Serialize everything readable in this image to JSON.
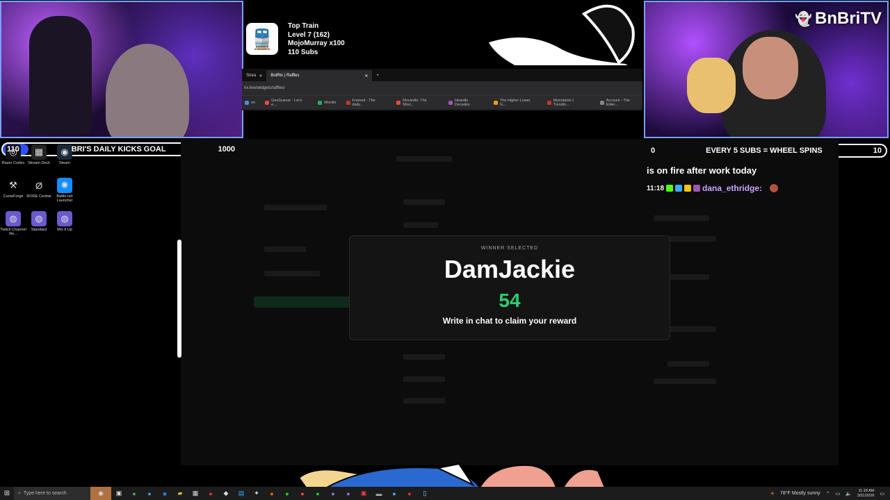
{
  "streamer": {
    "name": "BnBriTV"
  },
  "goals": {
    "left": {
      "current": "110",
      "label": "BRI'S DAILY KICKS GOAL",
      "target": "1000",
      "progress": 0.11
    },
    "right": {
      "current": "0",
      "label": "EVERY 5 SUBS = WHEEL SPINS",
      "target": "10",
      "progress": 0
    }
  },
  "desktop_icons": [
    {
      "label": "Razer Cortex",
      "icon": "razer-icon"
    },
    {
      "label": "Stream Deck",
      "icon": "stream-deck-icon"
    },
    {
      "label": "Steam",
      "icon": "steam-icon"
    },
    {
      "label": "CurseForge",
      "icon": "curseforge-icon"
    },
    {
      "label": "RODE Central",
      "icon": "rode-icon"
    },
    {
      "label": "Battle.net Launcher",
      "icon": "battlenet-icon"
    },
    {
      "label": "Twitch Channel Re...",
      "icon": "twitch-fingerprint-icon"
    },
    {
      "label": "Standard",
      "icon": "twitch-fingerprint-icon"
    },
    {
      "label": "Mix It Up",
      "icon": "twitch-fingerprint-icon"
    }
  ],
  "train": {
    "title": "Top Train",
    "level": "Level 7  (162)",
    "top_user": "MojoMurray x100",
    "subs": "110 Subs"
  },
  "browser": {
    "tabs": [
      {
        "label": "Strea"
      },
      {
        "label": "BotRix | Raffles"
      }
    ],
    "url": "rix.live/widgets/raffles/",
    "bookmarks": [
      {
        "label": "on",
        "color": "#4a90e2"
      },
      {
        "label": "GeoGuessr - Let's e...",
        "color": "#e74c3c"
      },
      {
        "label": "Wordle",
        "color": "#27ae60"
      },
      {
        "label": "Framed - The daily...",
        "color": "#c0392b"
      },
      {
        "label": "Moviedle: The Movi...",
        "color": "#e74c3c"
      },
      {
        "label": "Heardle Decades",
        "color": "#9b59b6"
      },
      {
        "label": "The Higher Lower G...",
        "color": "#f39c12"
      },
      {
        "label": "Myinstants | Trendin...",
        "color": "#c0392b"
      },
      {
        "label": "Account - The Elder...",
        "color": "#888888"
      }
    ]
  },
  "chat": {
    "line1": "is on fire after work today",
    "time": "11:18",
    "user": "dana_ethridge:"
  },
  "winner": {
    "caption": "WINNER SELECTED",
    "name": "DamJackie",
    "number": "54",
    "instruction": "Write in chat to claim your reward",
    "number_color": "#2ecc71"
  },
  "taskbar": {
    "search_placeholder": "Type here to search",
    "weather": "78°F  Mostly sunny",
    "time": "11:18 AM",
    "date": "3/31/2026"
  }
}
